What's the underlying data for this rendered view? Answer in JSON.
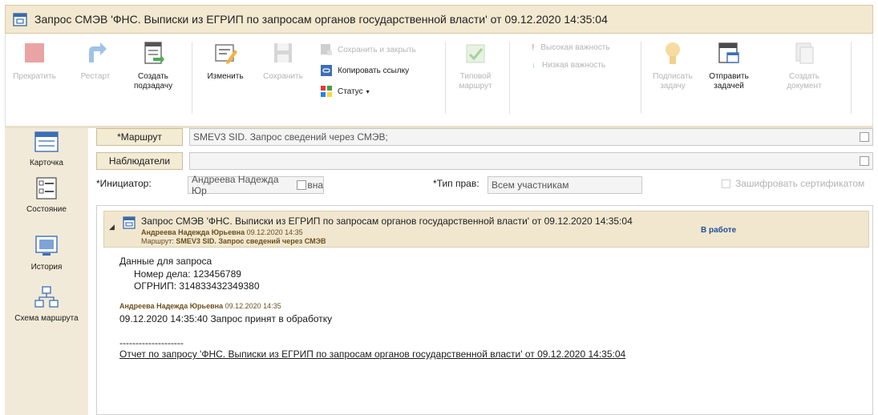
{
  "window": {
    "title": "Запрос СМЭВ 'ФНС. Выписки из ЕГРИП по запросам органов государственной власти' от 09.12.2020 14:35:04"
  },
  "ribbon": {
    "stop": "Прекратить",
    "restart": "Рестарт",
    "create_subtask_1": "Создать",
    "create_subtask_2": "подзадачу",
    "edit": "Изменить",
    "save": "Сохранить",
    "save_close": "Сохранить и закрыть",
    "copy_link": "Копировать ссылку",
    "status": "Статус",
    "typical_route_1": "Типовой",
    "typical_route_2": "маршрут",
    "high_importance": "Высокая важность",
    "low_importance": "Низкая важность",
    "sign_task_1": "Подписать",
    "sign_task_2": "задачу",
    "send_task_1": "Отправить",
    "send_task_2": "задачей",
    "create_doc_1": "Создать",
    "create_doc_2": "документ"
  },
  "nav": {
    "card": "Карточка",
    "state": "Состояние",
    "history": "История",
    "route_scheme": "Схема маршрута"
  },
  "form": {
    "route_button": "*Маршрут",
    "route_value": "SMEV3 SID. Запрос сведений через СМЭВ;",
    "watchers_button": "Наблюдатели",
    "watchers_value": "",
    "initiator_label": "*Инициатор:",
    "initiator_value_a": "Андреева Надежда Юр",
    "initiator_value_b": "вна",
    "rights_label": "*Тип прав:",
    "rights_value": "Всем участникам",
    "encrypt_label": "Зашифровать сертификатом"
  },
  "thread": {
    "title": "Запрос СМЭВ 'ФНС. Выписки из ЕГРИП по запросам органов государственной власти' от 09.12.2020 14:35:04",
    "author_name": "Андреева Надежда Юрьевна",
    "author_date": "09.12.2020 14:35",
    "route_label": "Маршрут:",
    "route_value": "SMEV3 SID. Запрос сведений через СМЭВ",
    "status": "В работе",
    "body_heading": "Данные для запроса",
    "case_number": "Номер дела: 123456789",
    "ogrnip": "ОГРНИП: 314833432349380",
    "reply_author": "Андреева Надежда Юрьевна",
    "reply_date": "09.12.2020 14:35",
    "reply_text": "09.12.2020 14:35:40 Запрос принят в обработку",
    "separator": "--------------------",
    "report_link": "Отчет по запросу 'ФНС. Выписки из ЕГРИП по запросам органов государственной власти' от 09.12.2020 14:35:04"
  },
  "colors": {
    "titlebar_bg": "#f3e8d0",
    "nav_bg": "#f2ead8",
    "status_blue": "#1f4f9a",
    "stop_red": "#e89a9a"
  }
}
